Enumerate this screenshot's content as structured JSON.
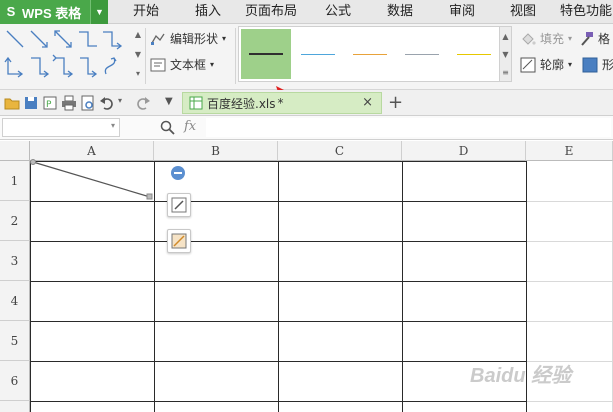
{
  "app": {
    "brand": "WPS 表格"
  },
  "menu": [
    "开始",
    "插入",
    "页面布局",
    "公式",
    "数据",
    "审阅",
    "视图",
    "特色功能"
  ],
  "ribbon": {
    "edit_shape": "编辑形状",
    "textbox": "文本框",
    "fill": "填充",
    "format": "格",
    "outline": "轮廓",
    "shape": "形",
    "line_styles": [
      {
        "color": "#2f2f2f",
        "selected": true
      },
      {
        "color": "#4ea6dc",
        "selected": false
      },
      {
        "color": "#e8a23a",
        "selected": false
      },
      {
        "color": "#9aa3ad",
        "selected": false
      },
      {
        "color": "#e6c800",
        "selected": false
      }
    ]
  },
  "tabs": {
    "file_name": "百度经验.xls",
    "modified_mark": "*",
    "close": "×",
    "add": "+"
  },
  "formula_bar": {
    "fx": "fx"
  },
  "sheet": {
    "columns": [
      "A",
      "B",
      "C",
      "D",
      "E"
    ],
    "rows": [
      "1",
      "2",
      "3",
      "4",
      "5",
      "6"
    ]
  },
  "colors": {
    "accent": "#4aa84a",
    "selected_swatch": "#9ed08a",
    "annotation": "#e02020"
  },
  "watermark": "Baidu 经验"
}
